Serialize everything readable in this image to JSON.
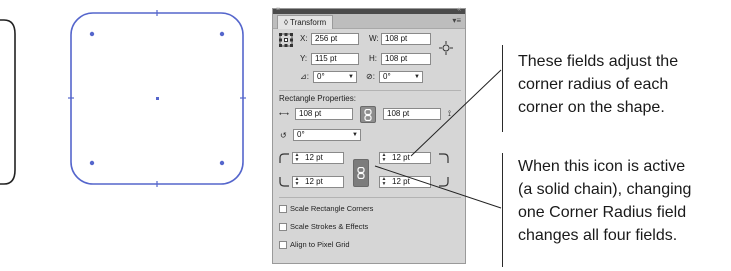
{
  "panel": {
    "tab_label": "◊ Transform",
    "close_glyph": "×",
    "collapse_glyph": "«",
    "menu_glyph": "▾≡",
    "x_label": "X:",
    "x_value": "256 pt",
    "w_label": "W:",
    "w_value": "108 pt",
    "y_label": "Y:",
    "y_value": "115 pt",
    "h_label": "H:",
    "h_value": "108 pt",
    "rotate_value": "0°",
    "shear_value": "0°",
    "rect_props_label": "Rectangle Properties:",
    "rect_w_value": "108 pt",
    "rect_h_value": "108 pt",
    "rect_rotate_value": "0°",
    "corner_tl": "12 pt",
    "corner_tr": "12 pt",
    "corner_bl": "12 pt",
    "corner_br": "12 pt",
    "options": [
      "Scale Rectangle Corners",
      "Scale Strokes & Effects",
      "Align to Pixel Grid"
    ]
  },
  "callouts": {
    "top": [
      "These fields adjust the",
      "corner radius of each",
      "corner on the shape."
    ],
    "bottom": [
      "When this icon is active",
      "(a solid chain), changing",
      "one Corner Radius field",
      "changes all four fields."
    ]
  },
  "colors": {
    "shape_stroke": "#5566cc",
    "panel_bg": "#d6d6d6",
    "chain_active": "#8e8e8e"
  }
}
